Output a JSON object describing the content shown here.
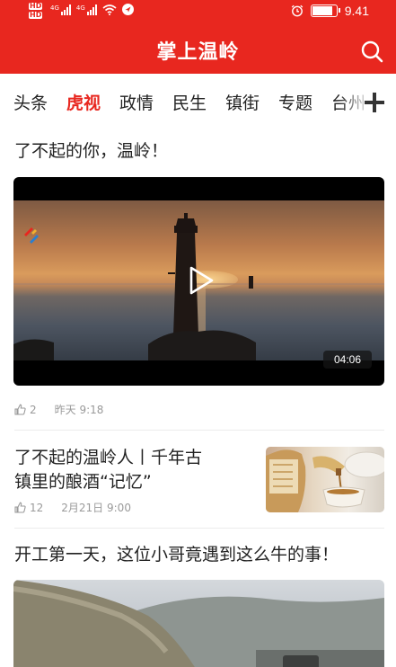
{
  "status_bar": {
    "time": "9.41",
    "sim_badges": [
      "HD",
      "HD"
    ],
    "network_labels": [
      "4G",
      "4G"
    ],
    "battery_level": 0.9
  },
  "header": {
    "title": "掌上温岭"
  },
  "tabs": [
    {
      "label": "头条",
      "active": false
    },
    {
      "label": "虎视",
      "active": true
    },
    {
      "label": "政情",
      "active": false
    },
    {
      "label": "民生",
      "active": false
    },
    {
      "label": "镇街",
      "active": false
    },
    {
      "label": "专题",
      "active": false
    },
    {
      "label": "台州",
      "active": false
    }
  ],
  "articles": [
    {
      "title": "了不起的你，温岭！",
      "duration": "04:06",
      "likes": "2",
      "date": "昨天 9:18"
    },
    {
      "title_line1": "了不起的温岭人丨千年古",
      "title_line2": "镇里的酿酒“记忆”",
      "likes": "12",
      "date": "2月21日 9:00"
    },
    {
      "title": "开工第一天，这位小哥竟遇到这么牛的事！"
    }
  ],
  "colors": {
    "brand": "#e8271f",
    "text": "#222222",
    "meta": "#9a9a9a"
  }
}
